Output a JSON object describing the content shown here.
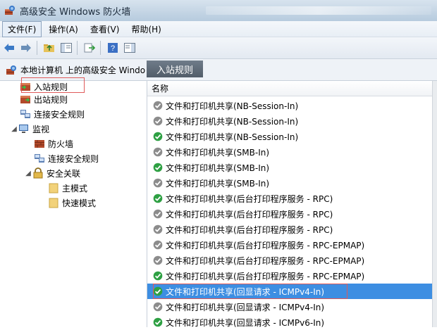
{
  "window": {
    "title": "高级安全 Windows 防火墙"
  },
  "menubar": {
    "items": [
      "文件(F)",
      "操作(A)",
      "查看(V)",
      "帮助(H)"
    ]
  },
  "toolbar": {
    "icons": [
      "back-arrow-icon",
      "forward-arrow-icon",
      "up-folder-icon",
      "show-hide-tree-icon",
      "export-list-icon",
      "help-icon",
      "properties-pane-icon"
    ]
  },
  "pathbar": {
    "root_label": "本地计算机 上的高级安全 Windo",
    "breadcrumb": "入站规则"
  },
  "tree": {
    "inbound": "入站规则",
    "outbound": "出站规则",
    "connection_security": "连接安全规则",
    "monitoring": "监视",
    "firewall": "防火墙",
    "monitor_connection_security": "连接安全规则",
    "security_associations": "安全关联",
    "main_mode": "主模式",
    "quick_mode": "快速模式"
  },
  "list": {
    "column_name": "名称",
    "rules": [
      {
        "name": "文件和打印机共享(NB-Session-In)",
        "enabled": false
      },
      {
        "name": "文件和打印机共享(NB-Session-In)",
        "enabled": false
      },
      {
        "name": "文件和打印机共享(NB-Session-In)",
        "enabled": true
      },
      {
        "name": "文件和打印机共享(SMB-In)",
        "enabled": false
      },
      {
        "name": "文件和打印机共享(SMB-In)",
        "enabled": true
      },
      {
        "name": "文件和打印机共享(SMB-In)",
        "enabled": false
      },
      {
        "name": "文件和打印机共享(后台打印程序服务 - RPC)",
        "enabled": true
      },
      {
        "name": "文件和打印机共享(后台打印程序服务 - RPC)",
        "enabled": false
      },
      {
        "name": "文件和打印机共享(后台打印程序服务 - RPC)",
        "enabled": false
      },
      {
        "name": "文件和打印机共享(后台打印程序服务 - RPC-EPMAP)",
        "enabled": false
      },
      {
        "name": "文件和打印机共享(后台打印程序服务 - RPC-EPMAP)",
        "enabled": false
      },
      {
        "name": "文件和打印机共享(后台打印程序服务 - RPC-EPMAP)",
        "enabled": true
      },
      {
        "name": "文件和打印机共享(回显请求 - ICMPv4-In)",
        "enabled": true,
        "selected": true
      },
      {
        "name": "文件和打印机共享(回显请求 - ICMPv4-In)",
        "enabled": false
      },
      {
        "name": "文件和打印机共享(回显请求 - ICMPv6-In)",
        "enabled": true
      }
    ]
  },
  "colors": {
    "enabled_green": "#2ea043",
    "disabled_gray": "#8c8c8c",
    "selection_blue": "#3d8ee2",
    "highlight_red": "#e05a5a"
  }
}
